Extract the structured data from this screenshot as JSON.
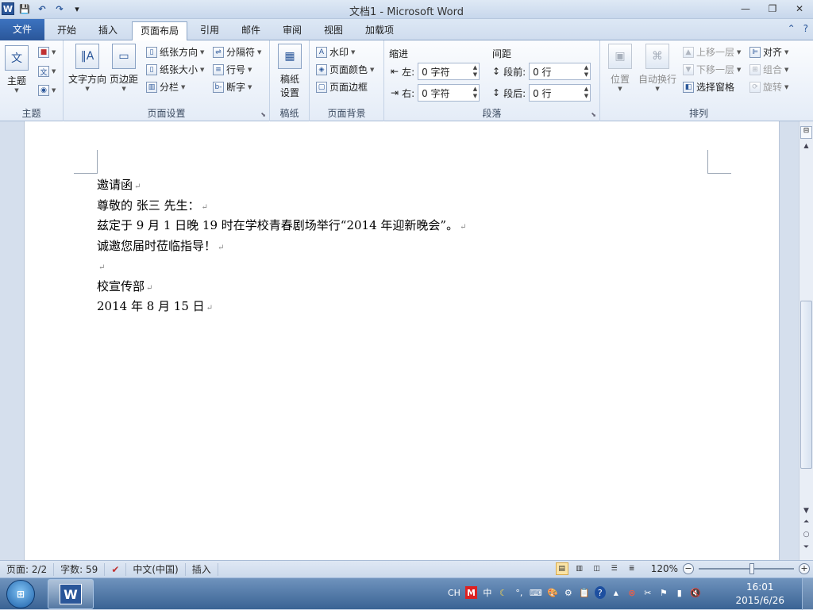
{
  "window": {
    "title": "文档1 - Microsoft Word",
    "controls": {
      "minimize": "—",
      "restore": "❐",
      "close": "✕"
    }
  },
  "qat": {
    "app_icon": "W",
    "save": "💾",
    "undo": "↶",
    "redo": "↷",
    "customize": "▾"
  },
  "tabs": {
    "file": "文件",
    "items": [
      "开始",
      "插入",
      "页面布局",
      "引用",
      "邮件",
      "审阅",
      "视图",
      "加载项"
    ],
    "active": "页面布局",
    "help_toggle": "⌃",
    "help": "?"
  },
  "ribbon": {
    "theme": {
      "label": "主题",
      "button": "主题",
      "colors": "■",
      "fonts": "文",
      "effects": "◉"
    },
    "page_setup": {
      "label": "页面设置",
      "text_direction": "文字方向",
      "margins": "页边距",
      "orientation": "纸张方向",
      "size": "纸张大小",
      "columns": "分栏",
      "breaks": "分隔符",
      "line_numbers": "行号",
      "hyphenation": "断字"
    },
    "manuscript": {
      "label": "稿纸",
      "button_line1": "稿纸",
      "button_line2": "设置"
    },
    "page_background": {
      "label": "页面背景",
      "watermark": "水印",
      "page_color": "页面颜色",
      "page_borders": "页面边框"
    },
    "paragraph": {
      "label": "段落",
      "indent_title": "缩进",
      "spacing_title": "间距",
      "indent_left_label": "左:",
      "indent_left_value": "0 字符",
      "indent_right_label": "右:",
      "indent_right_value": "0 字符",
      "spacing_before_label": "段前:",
      "spacing_before_value": "0 行",
      "spacing_after_label": "段后:",
      "spacing_after_value": "0 行"
    },
    "arrange": {
      "label": "排列",
      "position": "位置",
      "wrap_text": "自动换行",
      "bring_forward": "上移一层",
      "send_backward": "下移一层",
      "selection_pane": "选择窗格",
      "align": "对齐",
      "group": "组合",
      "rotate": "旋转"
    }
  },
  "document": {
    "paragraph_mark": "↵",
    "lines": [
      "邀请函",
      "尊敬的 张三 先生：",
      "兹定于 9 月 1 日晚 19 时在学校青春剧场举行“2014 年迎新晚会”。",
      "诚邀您届时莅临指导！",
      "",
      "校宣传部",
      "2014 年 8 月 15 日"
    ]
  },
  "statusbar": {
    "page": "页面: 2/2",
    "words": "字数: 59",
    "language": "中文(中国)",
    "mode": "插入",
    "zoom": "120%",
    "zoom_minus": "−",
    "zoom_plus": "+"
  },
  "taskbar": {
    "start": "⊞",
    "word_icon": "W",
    "tray": {
      "lang": "CH",
      "ime_m": "M",
      "ime_zh": "中",
      "moon": "☾",
      "punct": "°,",
      "keyboard": "⌨",
      "paint": "🎨",
      "tools": "⚙",
      "clipboard": "📋",
      "help": "?",
      "up": "▲",
      "stop": "⊗",
      "tool2": "✂",
      "flag": "⚑",
      "signal": "▮",
      "volume": "🔇"
    },
    "time": "16:01",
    "date": "2015/6/26"
  }
}
